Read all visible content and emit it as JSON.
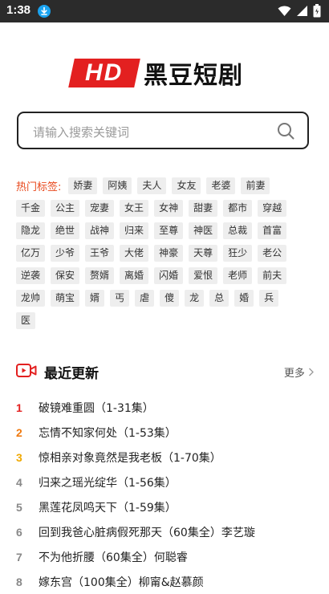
{
  "status_bar": {
    "time": "1:38",
    "accent": "#1aa3f0"
  },
  "logo": {
    "badge": "HD",
    "name": "黑豆短剧"
  },
  "search": {
    "placeholder": "请输入搜索关键词"
  },
  "tags": {
    "label": "热门标签:",
    "rows": [
      [
        "娇妻",
        "阿姨",
        "夫人",
        "女友",
        "老婆",
        "前妻"
      ],
      [
        "千金",
        "公主",
        "宠妻",
        "女王",
        "女神",
        "甜妻",
        "都市",
        "穿越"
      ],
      [
        "隐龙",
        "绝世",
        "战神",
        "归来",
        "至尊",
        "神医",
        "总裁",
        "首富"
      ],
      [
        "亿万",
        "少爷",
        "王爷",
        "大佬",
        "神豪",
        "天尊",
        "狂少",
        "老公"
      ],
      [
        "逆袭",
        "保安",
        "赘婿",
        "离婚",
        "闪婚",
        "爱恨",
        "老师",
        "前夫"
      ],
      [
        "龙帅",
        "萌宝",
        "婿",
        "丐",
        "虐",
        "傻",
        "龙",
        "总",
        "婚",
        "兵"
      ],
      [
        "医"
      ]
    ]
  },
  "recent": {
    "title": "最近更新",
    "more": "更多",
    "items": [
      {
        "rank": "1",
        "title": "破镜难重圆（1-31集）"
      },
      {
        "rank": "2",
        "title": "忘情不知家何处（1-53集）"
      },
      {
        "rank": "3",
        "title": "惊相亲对象竟然是我老板（1-70集）"
      },
      {
        "rank": "4",
        "title": "归来之瑶光绽华（1-56集）"
      },
      {
        "rank": "5",
        "title": "黑莲花凤鸣天下（1-59集）"
      },
      {
        "rank": "6",
        "title": "回到我爸心脏病假死那天（60集全）李艺璇"
      },
      {
        "rank": "7",
        "title": "不为他折腰（60集全）何聪睿"
      },
      {
        "rank": "8",
        "title": "嫁东宫（100集全）柳甯&赵慕颜"
      }
    ]
  },
  "colors": {
    "brand_red": "#e32020",
    "tag_label": "#e8481c"
  }
}
